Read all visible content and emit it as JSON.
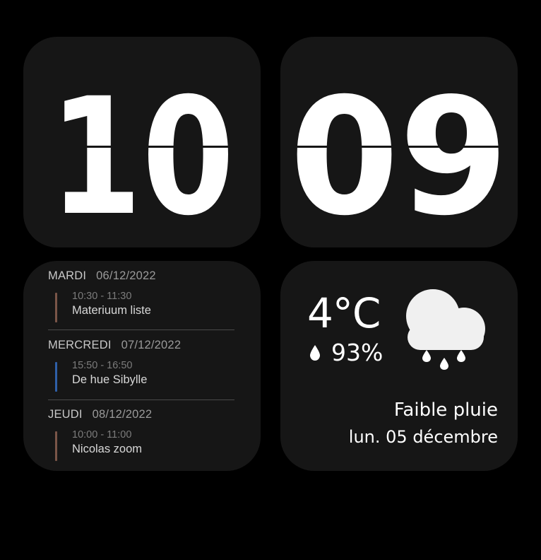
{
  "clock": {
    "hours": "10",
    "minutes": "09"
  },
  "calendar": {
    "days": [
      {
        "name": "MARDI",
        "date": "06/12/2022",
        "event": {
          "time": "10:30 - 11:30",
          "title": "Materiuum liste",
          "color": "#7a5548"
        }
      },
      {
        "name": "MERCREDI",
        "date": "07/12/2022",
        "event": {
          "time": "15:50 - 16:50",
          "title": "De hue Sibylle",
          "color": "#2f5fa8"
        }
      },
      {
        "name": "JEUDI",
        "date": "08/12/2022",
        "event": {
          "time": "10:00 - 11:00",
          "title": "Nicolas zoom",
          "color": "#7a5548"
        }
      }
    ]
  },
  "weather": {
    "temperature": "4°C",
    "humidity": "93%",
    "condition": "Faible pluie",
    "date": "lun. 05 décembre",
    "icon": "cloud-rain-icon",
    "humidity_icon": "water-drop-icon"
  },
  "colors": {
    "background": "#000000",
    "card": "#161616",
    "text": "#ffffff"
  }
}
